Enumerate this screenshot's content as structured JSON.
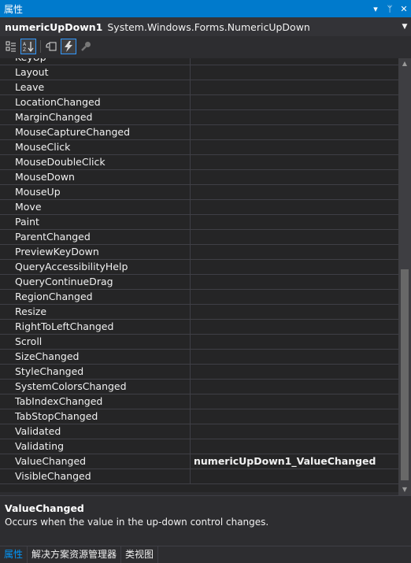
{
  "window": {
    "title": "属性"
  },
  "selector": {
    "object": "numericUpDown1",
    "type": "System.Windows.Forms.NumericUpDown"
  },
  "events": [
    {
      "name": "KeyUp",
      "value": ""
    },
    {
      "name": "Layout",
      "value": ""
    },
    {
      "name": "Leave",
      "value": ""
    },
    {
      "name": "LocationChanged",
      "value": ""
    },
    {
      "name": "MarginChanged",
      "value": ""
    },
    {
      "name": "MouseCaptureChanged",
      "value": ""
    },
    {
      "name": "MouseClick",
      "value": ""
    },
    {
      "name": "MouseDoubleClick",
      "value": ""
    },
    {
      "name": "MouseDown",
      "value": ""
    },
    {
      "name": "MouseUp",
      "value": ""
    },
    {
      "name": "Move",
      "value": ""
    },
    {
      "name": "Paint",
      "value": ""
    },
    {
      "name": "ParentChanged",
      "value": ""
    },
    {
      "name": "PreviewKeyDown",
      "value": ""
    },
    {
      "name": "QueryAccessibilityHelp",
      "value": ""
    },
    {
      "name": "QueryContinueDrag",
      "value": ""
    },
    {
      "name": "RegionChanged",
      "value": ""
    },
    {
      "name": "Resize",
      "value": ""
    },
    {
      "name": "RightToLeftChanged",
      "value": ""
    },
    {
      "name": "Scroll",
      "value": ""
    },
    {
      "name": "SizeChanged",
      "value": ""
    },
    {
      "name": "StyleChanged",
      "value": ""
    },
    {
      "name": "SystemColorsChanged",
      "value": ""
    },
    {
      "name": "TabIndexChanged",
      "value": ""
    },
    {
      "name": "TabStopChanged",
      "value": ""
    },
    {
      "name": "Validated",
      "value": ""
    },
    {
      "name": "Validating",
      "value": ""
    },
    {
      "name": "ValueChanged",
      "value": "numericUpDown1_ValueChanged"
    },
    {
      "name": "VisibleChanged",
      "value": ""
    }
  ],
  "description": {
    "title": "ValueChanged",
    "text": "Occurs when the value in the up-down control changes."
  },
  "tabs": [
    {
      "label": "属性",
      "active": true
    },
    {
      "label": "解决方案资源管理器",
      "active": false
    },
    {
      "label": "类视图",
      "active": false
    }
  ],
  "colors": {
    "accent": "#007acc",
    "background": "#2d2d30",
    "grid": "#252526"
  }
}
